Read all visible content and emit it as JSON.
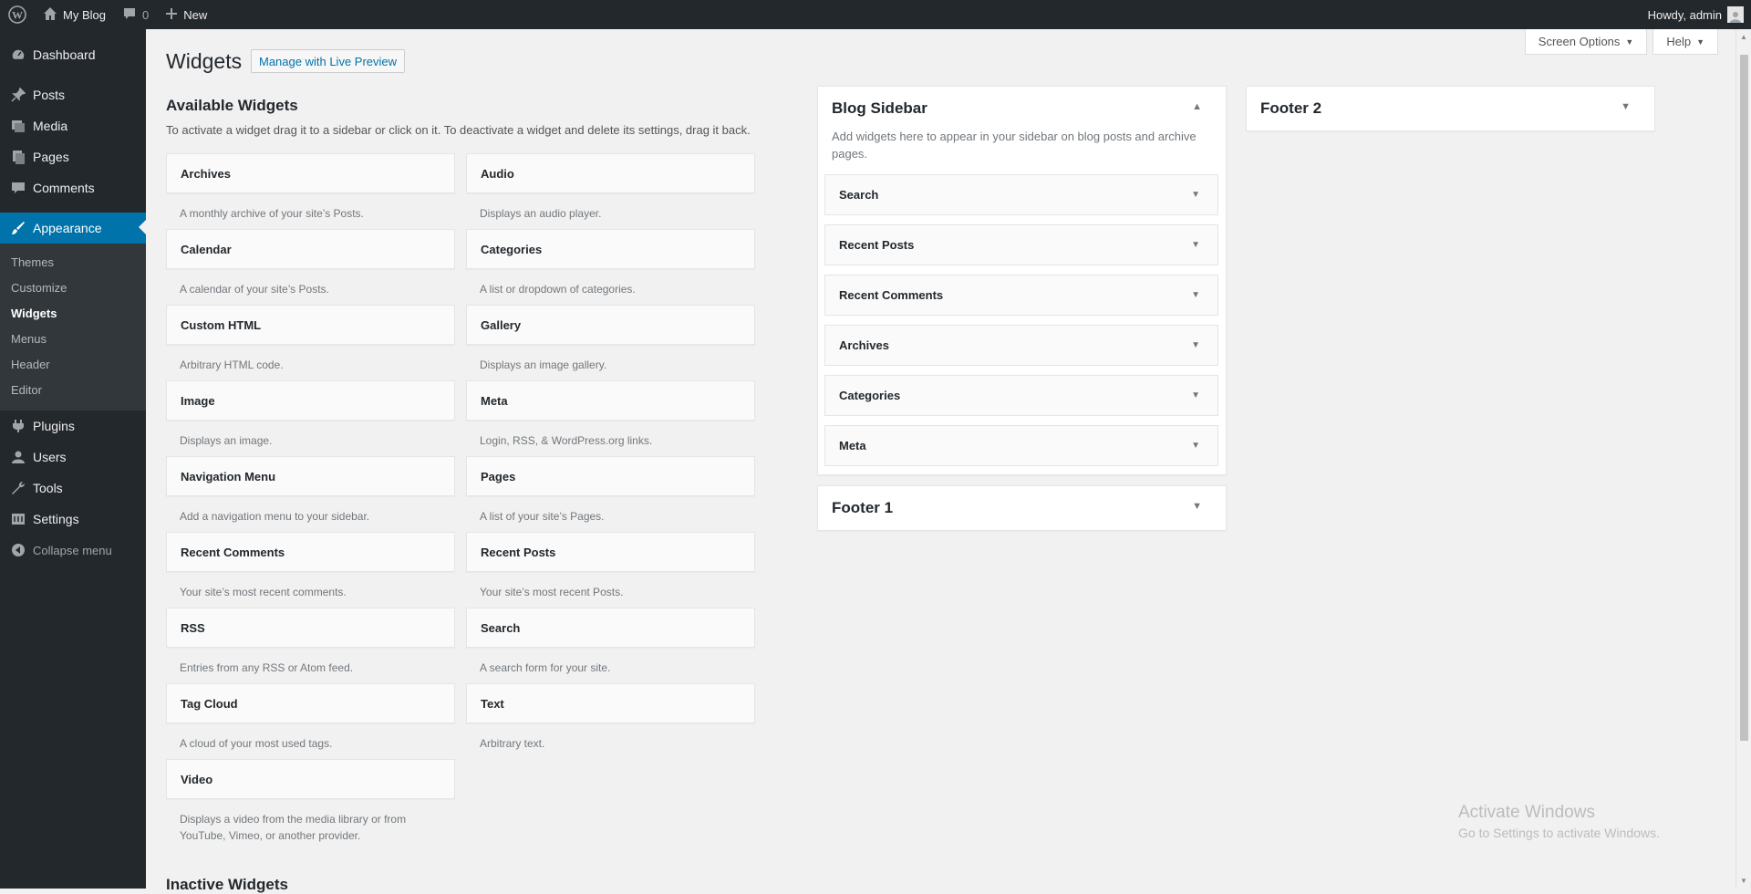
{
  "adminbar": {
    "site_name": "My Blog",
    "comments_count": "0",
    "new_label": "New",
    "howdy": "Howdy, admin"
  },
  "menu": {
    "dashboard": "Dashboard",
    "posts": "Posts",
    "media": "Media",
    "pages": "Pages",
    "comments": "Comments",
    "appearance": "Appearance",
    "submenu": [
      "Themes",
      "Customize",
      "Widgets",
      "Menus",
      "Header",
      "Editor"
    ],
    "plugins": "Plugins",
    "users": "Users",
    "tools": "Tools",
    "settings": "Settings",
    "collapse": "Collapse menu"
  },
  "header": {
    "screen_options": "Screen Options",
    "help": "Help",
    "title": "Widgets",
    "live_preview": "Manage with Live Preview"
  },
  "available": {
    "heading": "Available Widgets",
    "description": "To activate a widget drag it to a sidebar or click on it. To deactivate a widget and delete its settings, drag it back.",
    "widgets": [
      {
        "name": "Archives",
        "desc": "A monthly archive of your site’s Posts."
      },
      {
        "name": "Audio",
        "desc": "Displays an audio player."
      },
      {
        "name": "Calendar",
        "desc": "A calendar of your site’s Posts."
      },
      {
        "name": "Categories",
        "desc": "A list or dropdown of categories."
      },
      {
        "name": "Custom HTML",
        "desc": "Arbitrary HTML code."
      },
      {
        "name": "Gallery",
        "desc": "Displays an image gallery."
      },
      {
        "name": "Image",
        "desc": "Displays an image."
      },
      {
        "name": "Meta",
        "desc": "Login, RSS, & WordPress.org links."
      },
      {
        "name": "Navigation Menu",
        "desc": "Add a navigation menu to your sidebar."
      },
      {
        "name": "Pages",
        "desc": "A list of your site’s Pages."
      },
      {
        "name": "Recent Comments",
        "desc": "Your site’s most recent comments."
      },
      {
        "name": "Recent Posts",
        "desc": "Your site’s most recent Posts."
      },
      {
        "name": "RSS",
        "desc": "Entries from any RSS or Atom feed."
      },
      {
        "name": "Search",
        "desc": "A search form for your site."
      },
      {
        "name": "Tag Cloud",
        "desc": "A cloud of your most used tags."
      },
      {
        "name": "Text",
        "desc": "Arbitrary text."
      },
      {
        "name": "Video",
        "desc": "Displays a video from the media library or from YouTube, Vimeo, or another provider."
      }
    ]
  },
  "inactive": {
    "heading": "Inactive Widgets"
  },
  "sidebars": {
    "blog": {
      "title": "Blog Sidebar",
      "description": "Add widgets here to appear in your sidebar on blog posts and archive pages.",
      "widgets": [
        "Search",
        "Recent Posts",
        "Recent Comments",
        "Archives",
        "Categories",
        "Meta"
      ]
    },
    "footer1": {
      "title": "Footer 1"
    },
    "footer2": {
      "title": "Footer 2"
    }
  },
  "watermark": {
    "line1": "Activate Windows",
    "line2": "Go to Settings to activate Windows."
  }
}
